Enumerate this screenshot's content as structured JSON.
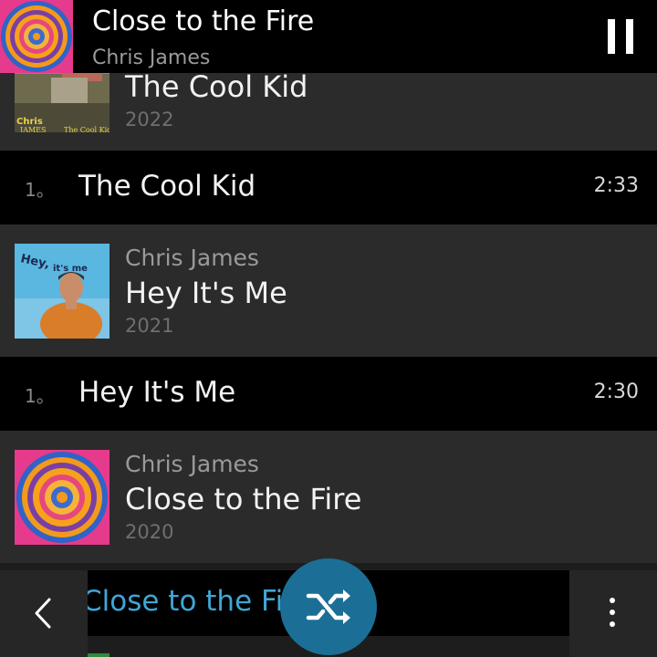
{
  "now_playing": {
    "title": "Close to the Fire",
    "artist": "Chris James",
    "art_icon": "spiral-album-art",
    "pause_icon": "pause-icon"
  },
  "albums": [
    {
      "artist": "",
      "title": "The Cool Kid",
      "year": "2022",
      "art_icon": "collage-album-art",
      "art_text": "Chris James  The Cool Kid"
    },
    {
      "artist": "Chris James",
      "title": "Hey It's Me",
      "year": "2021",
      "art_icon": "portrait-album-art",
      "art_text": "Hey, it's me"
    },
    {
      "artist": "Chris James",
      "title": "Close to the Fire",
      "year": "2020",
      "art_icon": "spiral-album-art",
      "art_text": ""
    }
  ],
  "tracks": [
    {
      "number": "1",
      "title": "The Cool Kid",
      "duration": "2:33"
    },
    {
      "number": "1",
      "title": "Hey It's Me",
      "duration": "2:30"
    }
  ],
  "bottom_bar": {
    "title_strip": "Close to the Fire",
    "back_icon": "chevron-left-icon",
    "shuffle_icon": "shuffle-icon",
    "menu_icon": "more-vertical-icon"
  },
  "colors": {
    "accent": "#1b6f96",
    "accent_text": "#3fa6d6",
    "album_row_bg": "#2b2b2b",
    "track_row_bg": "#000000"
  }
}
